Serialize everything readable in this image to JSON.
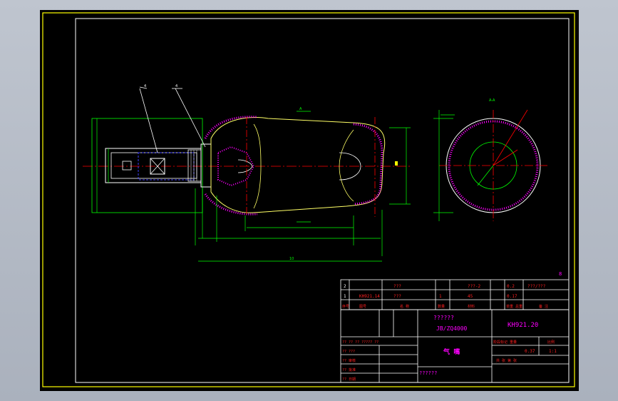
{
  "colors": {
    "frame": "#ffff00",
    "outline": "#ffffff",
    "center_line": "#ff0000",
    "dimension": "#00ff00",
    "title_text": "#ff00ff",
    "table_text": "#ff2020",
    "hatch": "#ff00ff",
    "contour": "#ffff66"
  },
  "drawing": {
    "sheet_number": "8",
    "dim_total": "10",
    "dim_label_a": "4",
    "dim_label_b": "4",
    "section_label_top": "A",
    "side_view_label": "A-A"
  },
  "parts_list": {
    "rows": [
      {
        "no": "2",
        "code": "",
        "name": "???",
        "qty": "",
        "material": "???-2",
        "mass": "0.2",
        "note": "???/???"
      },
      {
        "no": "1",
        "code": "KH921.14",
        "name": "???",
        "qty": "1",
        "material": "45",
        "mass": "0.17",
        "note": ""
      }
    ],
    "header": {
      "no": "序号",
      "code": "图号",
      "name": "名 称",
      "qty": "数量",
      "material": "材料",
      "mass": "单重 总重",
      "note": "备 注"
    }
  },
  "title_block": {
    "company_line1": "??????",
    "company_line2": "JB/ZQ4000",
    "drawing_code": "KH921.20",
    "part_name": "气 嘴",
    "scale_label": "比例",
    "scale_value": "1:1",
    "weight_value": "0.37",
    "stage_label": "阶段标记 重量",
    "sheet_label": "共    张 第    张",
    "footer_note": "??????",
    "sign_rows": [
      "?? ?? ?? ????? ??",
      "??   ???",
      "??   审核",
      "??   批准",
      "??   日期"
    ],
    "sign_labels": [
      "标记",
      "设计",
      "审核",
      "工艺",
      "日期"
    ]
  }
}
